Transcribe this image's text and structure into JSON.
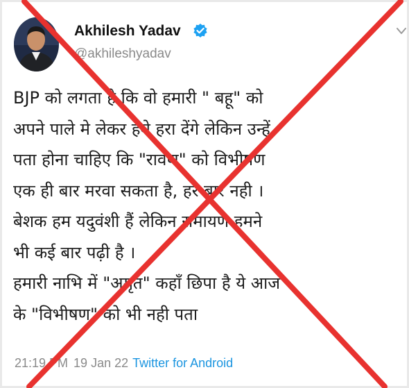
{
  "tweet": {
    "author_name": "Akhilesh Yadav",
    "author_handle": "@akhileshyadav",
    "body_lines": [
      "BJP को लगता है कि वो हमारी \" बहू\" को",
      "अपने पाले मे लेकर हमे हरा देंगे लेकिन उन्हें",
      "पता होना चाहिए कि \"रावण\" को विभीषण",
      "एक ही बार मरवा सकता है, हर बार नही ।",
      "बेशक हम यदुवंशी हैं लेकिन रामायण हमने",
      "भी कई बार पढ़ी है ।",
      "हमारी नाभि में \"अमृत\" कहाँ छिपा है ये आज",
      "के \"विभीषण\" को भी नही पता"
    ],
    "time": "21:19 PM",
    "date": "19 Jan 22",
    "source": "Twitter for Android"
  },
  "icons": {
    "verified": "verified-badge-icon",
    "menu": "chevron-down-icon",
    "avatar": "profile-photo"
  },
  "colors": {
    "cross": "#e8322f",
    "verified": "#1da1f2",
    "handle": "#8a8a8a",
    "source_link": "#1b95e0"
  }
}
